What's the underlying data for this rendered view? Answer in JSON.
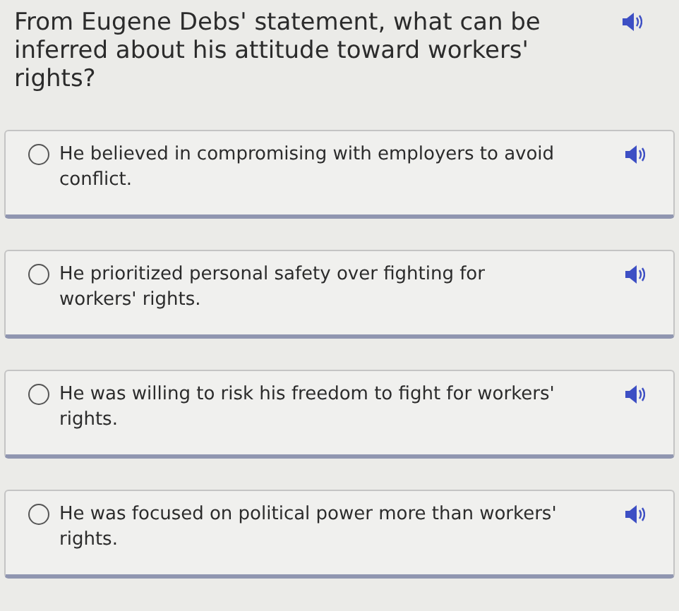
{
  "question": {
    "text": "From Eugene Debs' statement, what can be inferred about his attitude toward workers' rights?"
  },
  "options": [
    {
      "text": "He believed in compromising with employers to avoid conflict.",
      "selected": false
    },
    {
      "text": "He prioritized personal safety over fighting for workers' rights.",
      "selected": false
    },
    {
      "text": "He was willing to risk his freedom to fight for workers' rights.",
      "selected": false
    },
    {
      "text": "He was focused on political power more than workers' rights.",
      "selected": false
    }
  ]
}
